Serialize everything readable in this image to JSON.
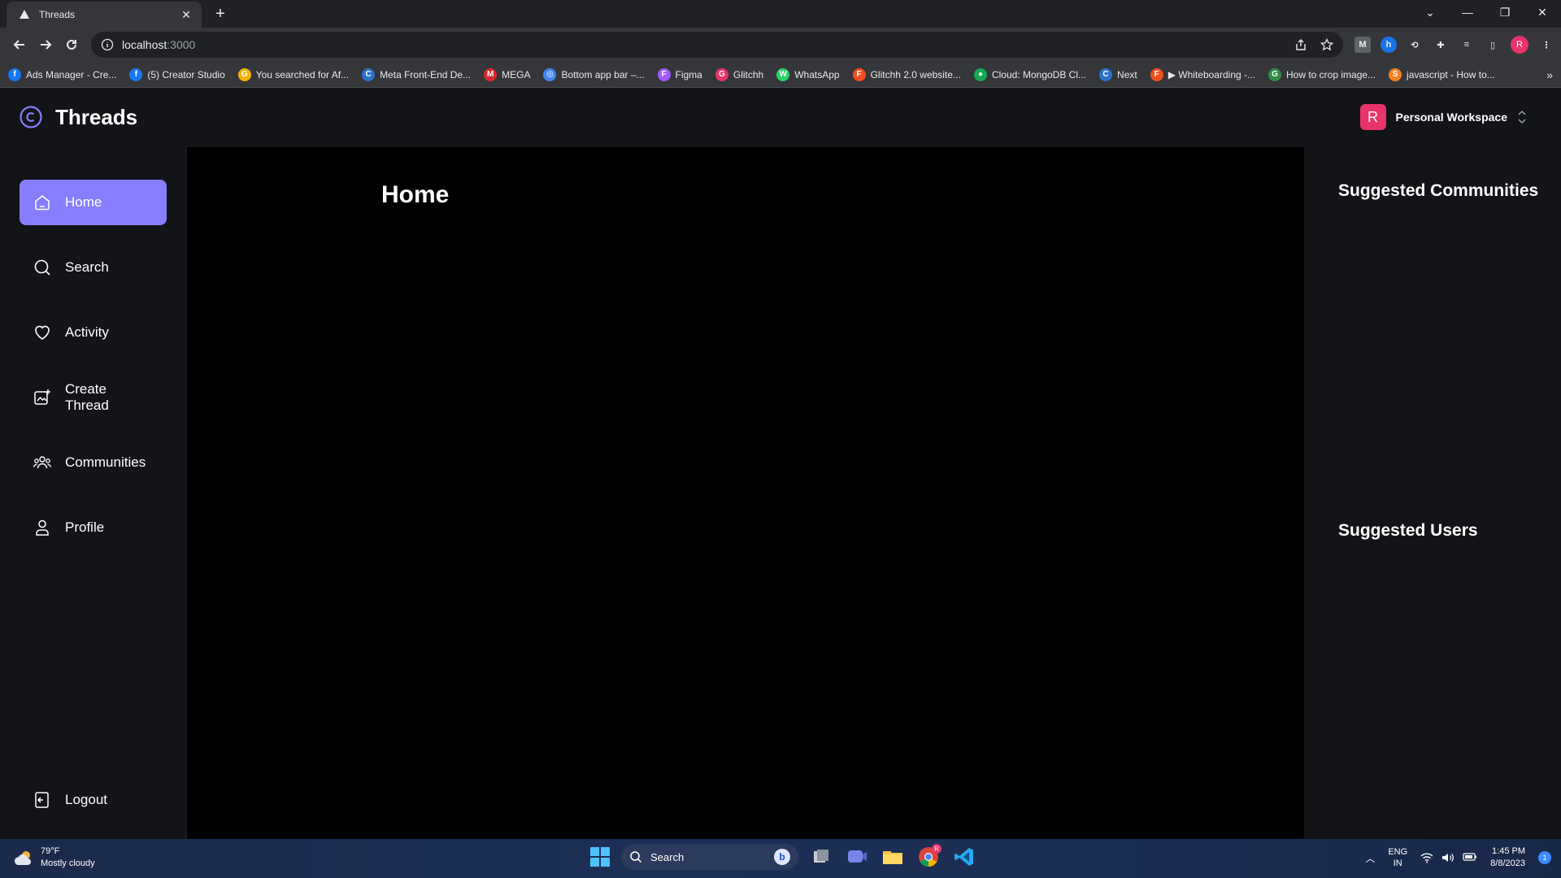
{
  "browser": {
    "tab_title": "Threads",
    "url_host": "localhost",
    "url_port": ":3000",
    "bookmarks": [
      {
        "label": "Ads Manager - Cre...",
        "icon": "facebook-icon",
        "color": "#1877f2",
        "glyph": "f"
      },
      {
        "label": "(5) Creator Studio",
        "icon": "facebook-icon",
        "color": "#1877f2",
        "glyph": "f"
      },
      {
        "label": "You searched for Af...",
        "icon": "google-icon",
        "color": "#f4b400",
        "glyph": "G"
      },
      {
        "label": "Meta Front-End De...",
        "icon": "coursera-icon",
        "color": "#2a73cc",
        "glyph": "C"
      },
      {
        "label": "MEGA",
        "icon": "mega-icon",
        "color": "#d9272e",
        "glyph": "M"
      },
      {
        "label": "Bottom app bar –...",
        "icon": "material-icon",
        "color": "#4285f4",
        "glyph": "◎"
      },
      {
        "label": "Figma",
        "icon": "figma-icon",
        "color": "#a259ff",
        "glyph": "F"
      },
      {
        "label": "Glitchh",
        "icon": "glitch-icon",
        "color": "#e8336b",
        "glyph": "G"
      },
      {
        "label": "WhatsApp",
        "icon": "whatsapp-icon",
        "color": "#25d366",
        "glyph": "W"
      },
      {
        "label": "Glitchh 2.0 website...",
        "icon": "figma-icon",
        "color": "#f24e1e",
        "glyph": "F"
      },
      {
        "label": "Cloud: MongoDB Cl...",
        "icon": "mongodb-icon",
        "color": "#13aa52",
        "glyph": "●"
      },
      {
        "label": "Next",
        "icon": "coursera-icon",
        "color": "#2a73cc",
        "glyph": "C"
      },
      {
        "label": "▶ Whiteboarding -...",
        "icon": "figma-icon",
        "color": "#f24e1e",
        "glyph": "F"
      },
      {
        "label": "How to crop image...",
        "icon": "gfg-icon",
        "color": "#2f8d46",
        "glyph": "G"
      },
      {
        "label": "javascript - How to...",
        "icon": "stackoverflow-icon",
        "color": "#f48024",
        "glyph": "S"
      }
    ]
  },
  "app": {
    "title": "Threads",
    "workspace": {
      "initial": "R",
      "label": "Personal Workspace"
    },
    "nav": [
      {
        "label": "Home",
        "icon": "home-icon",
        "active": true
      },
      {
        "label": "Search",
        "icon": "search-icon",
        "active": false
      },
      {
        "label": "Activity",
        "icon": "heart-icon",
        "active": false
      },
      {
        "label": "Create Thread",
        "icon": "create-thread-icon",
        "active": false
      },
      {
        "label": "Communities",
        "icon": "communities-icon",
        "active": false
      },
      {
        "label": "Profile",
        "icon": "user-icon",
        "active": false
      }
    ],
    "logout": {
      "label": "Logout",
      "icon": "logout-icon"
    },
    "page_heading": "Home",
    "right": {
      "suggested_communities": "Suggested Communities",
      "suggested_users": "Suggested Users"
    },
    "accent": "#877eff"
  },
  "taskbar": {
    "weather_temp": "79°F",
    "weather_desc": "Mostly cloudy",
    "search_label": "Search",
    "lang_top": "ENG",
    "lang_bottom": "IN",
    "time": "1:45 PM",
    "date": "8/8/2023",
    "notif_count": "1",
    "chrome_badge": "R"
  }
}
